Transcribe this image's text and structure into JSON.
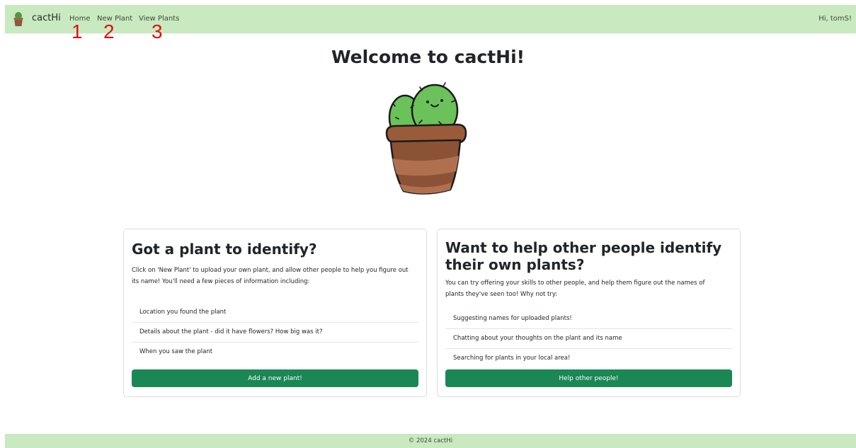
{
  "navbar": {
    "brand": "cactHi",
    "links": [
      {
        "label": "Home"
      },
      {
        "label": "New Plant"
      },
      {
        "label": "View Plants"
      }
    ],
    "greeting": "Hi, tomS!"
  },
  "annotations": [
    "1",
    "2",
    "3"
  ],
  "main": {
    "welcome": "Welcome to cactHi!"
  },
  "cards": [
    {
      "title": "Got a plant to identify?",
      "text": "Click on 'New Plant' to upload your own plant, and allow other people to help you figure out its name! You'll need a few pieces of information including:",
      "items": [
        "Location you found the plant",
        "Details about the plant - did it have flowers? How big was it?",
        "When you saw the plant"
      ],
      "button": "Add a new plant!"
    },
    {
      "title": "Want to help other people identify their own plants?",
      "text": "You can try offering your skills to other people, and help them figure out the names of plants they've seen too! Why not try:",
      "items": [
        "Suggesting names for uploaded plants!",
        "Chatting about your thoughts on the plant and its name",
        "Searching for plants in your local area!"
      ],
      "button": "Help other people!"
    }
  ],
  "footer": {
    "text": "© 2024 cactHi"
  },
  "colors": {
    "nav_bg": "#c9e9c0",
    "button_bg": "#1a8754",
    "annotation": "#e01010"
  }
}
